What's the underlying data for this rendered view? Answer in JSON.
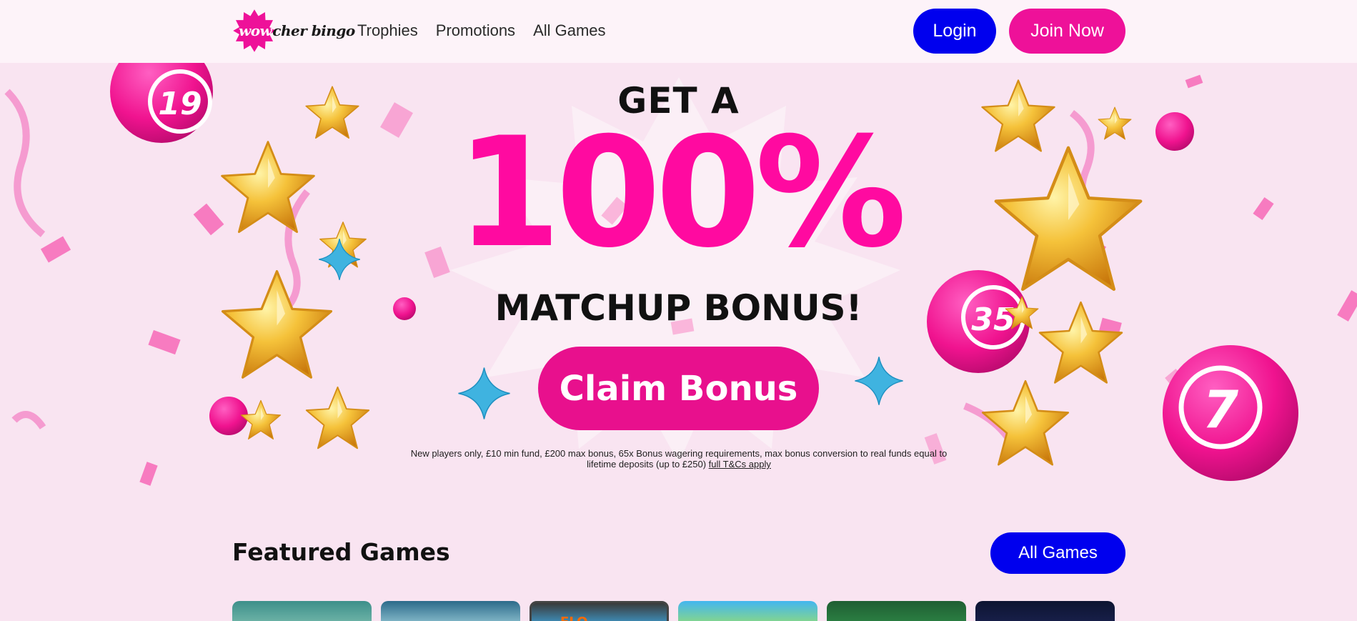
{
  "header": {
    "logo": {
      "wow": "wow",
      "rest": "cher bingo"
    },
    "nav": [
      "Trophies",
      "Promotions",
      "All Games"
    ],
    "login_label": "Login",
    "join_label": "Join Now"
  },
  "hero": {
    "line1": "GET A",
    "line2": "100%",
    "line3": "MATCHUP BONUS!",
    "cta_label": "Claim Bonus",
    "terms_text": "New players only, £10 min fund, £200 max bonus, 65x Bonus wagering requirements, max bonus conversion to real funds equal to lifetime deposits (up to £250) ",
    "terms_link": "full T&Cs apply",
    "ball_numbers": [
      "19",
      "35",
      "7"
    ]
  },
  "featured": {
    "title": "Featured Games",
    "all_games_label": "All Games",
    "tile_partial_text": "FLO..."
  },
  "colors": {
    "brand_pink": "#ee1199",
    "hero_pink": "#ff0aa0",
    "brand_blue": "#0000ee",
    "hero_bg": "#f9e4f1",
    "header_bg": "#fdf3f9"
  },
  "icons": [
    "logo-burst-icon",
    "star-icon",
    "bingo-ball-icon",
    "sparkle-icon",
    "confetti-icon"
  ]
}
